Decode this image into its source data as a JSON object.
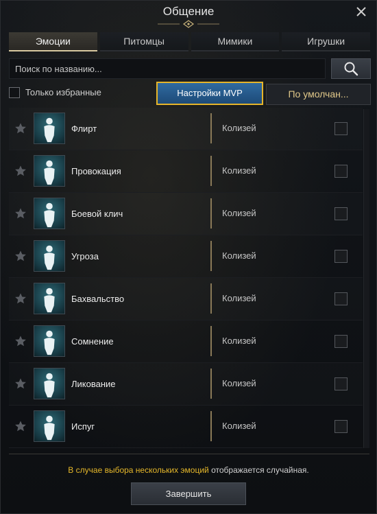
{
  "window": {
    "title": "Общение",
    "close_icon": "close-icon"
  },
  "tabs": [
    {
      "label": "Эмоции",
      "active": true
    },
    {
      "label": "Питомцы",
      "active": false
    },
    {
      "label": "Мимики",
      "active": false
    },
    {
      "label": "Игрушки",
      "active": false
    }
  ],
  "search": {
    "placeholder": "Поиск по названию...",
    "value": "",
    "icon": "search-icon"
  },
  "filters": {
    "favorites_only_label": "Только избранные",
    "favorites_only_checked": false,
    "mvp_button": "Настройки MVP",
    "default_button": "По умолчан..."
  },
  "emotes": [
    {
      "name": "Флирт",
      "location": "Колизей",
      "favorite": false,
      "checked": false,
      "icon": "flirt-emote-icon"
    },
    {
      "name": "Провокация",
      "location": "Колизей",
      "favorite": false,
      "checked": false,
      "icon": "provocation-emote-icon"
    },
    {
      "name": "Боевой клич",
      "location": "Колизей",
      "favorite": false,
      "checked": false,
      "icon": "battle-cry-emote-icon"
    },
    {
      "name": "Угроза",
      "location": "Колизей",
      "favorite": false,
      "checked": false,
      "icon": "threat-emote-icon"
    },
    {
      "name": "Бахвальство",
      "location": "Колизей",
      "favorite": false,
      "checked": false,
      "icon": "boast-emote-icon"
    },
    {
      "name": "Сомнение",
      "location": "Колизей",
      "favorite": false,
      "checked": false,
      "icon": "doubt-emote-icon"
    },
    {
      "name": "Ликование",
      "location": "Колизей",
      "favorite": false,
      "checked": false,
      "icon": "rejoice-emote-icon"
    },
    {
      "name": "Испуг",
      "location": "Колизей",
      "favorite": false,
      "checked": false,
      "icon": "fright-emote-icon"
    }
  ],
  "footer": {
    "notice_highlight": "В случае выбора нескольких эмоций",
    "notice_rest": " отображается случайная.",
    "finish_button": "Завершить"
  },
  "colors": {
    "accent_gold": "#e6b82a",
    "mvp_blue": "#2f6aa0",
    "default_text": "#e2c98a"
  }
}
